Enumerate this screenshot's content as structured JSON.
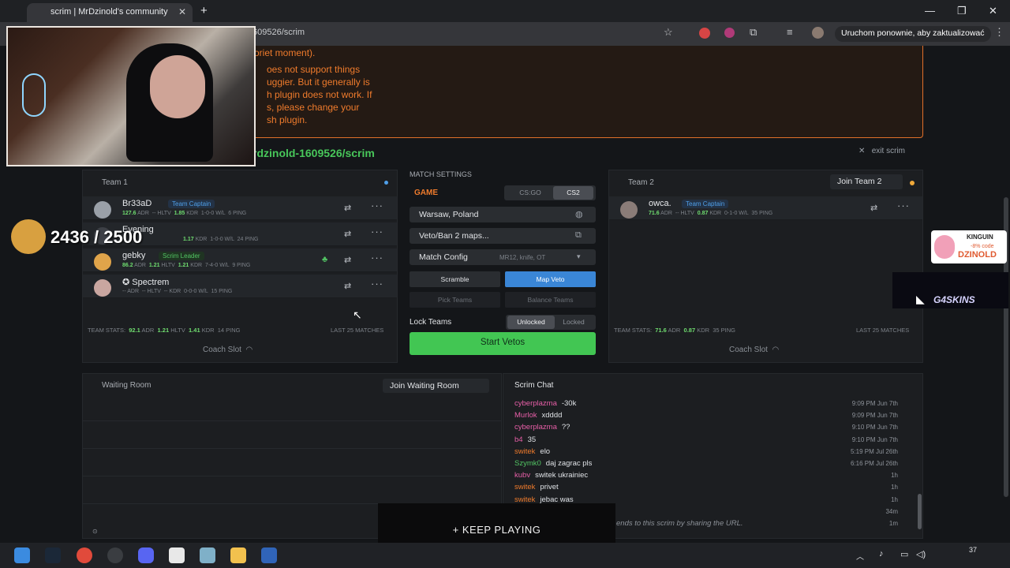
{
  "browser": {
    "tab_title": "scrim | MrDzinold's community",
    "url_fragment": "609526/scrim",
    "update_button": "Uruchom ponownie, aby zaktualizować",
    "new_tab_symbol": "+",
    "close_symbol": "✕"
  },
  "warning": {
    "lines": [
      "oriet moment).",
      "oes not support things",
      "uggier. But it generally is",
      "h plugin does not work. If",
      "s, please change your",
      "sh plugin."
    ]
  },
  "scrim": {
    "title": "rdzinold-1609526/scrim",
    "exit_label": "exit scrim"
  },
  "team1": {
    "title": "Team 1",
    "players": [
      {
        "name": "Br33aD",
        "badge": "Team Captain",
        "adr": "127.6",
        "hltv": "--",
        "kdr": "1.85",
        "wl": "1-0-0",
        "ping": "6"
      },
      {
        "name": "Evening",
        "badge": "",
        "adr": "",
        "hltv": "",
        "kdr": "1.17",
        "wl": "1-0-0",
        "ping": "24"
      },
      {
        "name": "gebky",
        "badge": "Scrim Leader",
        "adr": "86.2",
        "hltv": "1.21",
        "kdr": "1.21",
        "wl": "7-4-0",
        "ping": "9"
      },
      {
        "name": "✪ Spectrem",
        "badge": "",
        "adr": "--",
        "hltv": "--",
        "kdr": "--",
        "wl": "0-0-0",
        "ping": "15"
      }
    ],
    "stats": {
      "adr": "92.1",
      "hltv": "1.21",
      "kdr": "1.41",
      "ping": "14"
    },
    "last_matches": "LAST 25 MATCHES",
    "coach_slot": "Coach Slot"
  },
  "team2": {
    "title": "Team 2",
    "join_label": "Join Team 2",
    "players": [
      {
        "name": "owca.",
        "badge": "Team Captain",
        "adr": "71.6",
        "hltv": "--",
        "kdr": "0.87",
        "wl": "0-1-0",
        "ping": "35"
      }
    ],
    "stats": {
      "adr": "71.6",
      "kdr": "0.87",
      "ping": "35"
    },
    "last_matches": "LAST 25 MATCHES",
    "coach_slot": "Coach Slot"
  },
  "match_settings": {
    "header": "MATCH SETTINGS",
    "game_label": "GAME",
    "game_options": [
      "CS:GO",
      "CS2"
    ],
    "game_selected": "CS2",
    "location": "Warsaw, Poland",
    "veto": "Veto/Ban 2 maps...",
    "config_label": "Match Config",
    "config_value": "MR12, knife, OT",
    "buttons": [
      "Scramble",
      "Map Veto",
      "Pick Teams",
      "Balance Teams"
    ],
    "lock_label": "Lock Teams",
    "lock_options": [
      "Unlocked",
      "Locked"
    ],
    "start_button": "Start Vetos"
  },
  "waiting_room": {
    "title": "Waiting Room",
    "join_label": "Join Waiting Room"
  },
  "chat": {
    "title": "Scrim Chat",
    "messages": [
      {
        "user": "cyberplazma",
        "color": "#e85fa8",
        "text": "-30k",
        "time": "9:09 PM Jun 7th"
      },
      {
        "user": "Murlok",
        "color": "#e85fa8",
        "text": "xdddd",
        "time": "9:09 PM Jun 7th"
      },
      {
        "user": "cyberplazma",
        "color": "#e85fa8",
        "text": "??",
        "time": "9:10 PM Jun 7th"
      },
      {
        "user": "b4",
        "color": "#e85fa8",
        "text": "35",
        "time": "9:10 PM Jun 7th"
      },
      {
        "user": "switek",
        "color": "#ef7b2c",
        "text": "elo",
        "time": "5:19 PM Jul 26th"
      },
      {
        "user": "Szymk0",
        "color": "#52c463",
        "text": "daj zagrac pls",
        "time": "6:16 PM Jul 26th"
      },
      {
        "user": "kubv",
        "color": "#e85fa8",
        "text": "switek ukrainiec",
        "time": "1h"
      },
      {
        "user": "switek",
        "color": "#ef7b2c",
        "text": "privet",
        "time": "1h"
      },
      {
        "user": "switek",
        "color": "#ef7b2c",
        "text": "jebac was",
        "time": "1h"
      },
      {
        "user": "",
        "color": "#ef7b2c",
        "text": "",
        "time": "34m"
      },
      {
        "user": "",
        "color": "#ef7b2c",
        "text": "",
        "time": "1m"
      }
    ],
    "share_text": "ends to this scrim by sharing the URL."
  },
  "overlay": {
    "counter": "2436 / 2500",
    "keep_playing": "KEEP PLAYING",
    "kinguin_brand": "KINGUIN",
    "kinguin_code": "-8% code",
    "kinguin_name": "DZINOLD",
    "g4skins": "G4SKINS"
  },
  "taskbar": {
    "time": "37"
  }
}
